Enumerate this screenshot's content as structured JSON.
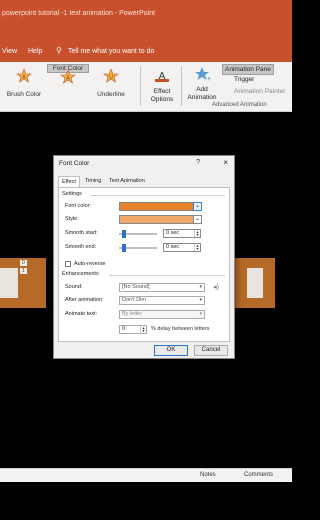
{
  "titlebar": {
    "title": "powerpoint tutorial -1 text animation  -  PowerPoint"
  },
  "menubar": {
    "view": "View",
    "help": "Help",
    "tell_me": "Tell me what you want to do"
  },
  "ribbon": {
    "buttons": [
      {
        "label": "Brush Color"
      },
      {
        "label": "Font Color"
      },
      {
        "label": "Underline"
      }
    ],
    "effect_options": "Effect Options",
    "add_animation": "Add Animation",
    "animation_pane": "Animation Pane",
    "trigger": "Trigger",
    "animation_painter": "Animation Painter",
    "group_label": "Advanced Animation"
  },
  "status": {
    "notes": "Notes",
    "comments": "Comments"
  },
  "slide": {
    "badge_top": "0",
    "badge_bottom": "1"
  },
  "dialog": {
    "title": "Font Color",
    "help": "?",
    "close": "×",
    "tabs": [
      "Effect",
      "Timing",
      "Text Animation"
    ],
    "settings_label": "Settings",
    "font_color_label": "Font color:",
    "style_label": "Style:",
    "smooth_start_label": "Smooth start:",
    "smooth_end_label": "Smooth end:",
    "smooth_start_value": "0 sec",
    "smooth_end_value": "0 sec",
    "auto_reverse_label": "Auto-reverse",
    "enhancements_label": "Enhancements",
    "sound_label": "Sound:",
    "sound_value": "[No Sound]",
    "after_animation_label": "After animation:",
    "after_animation_value": "Don't Dim",
    "animate_text_label": "Animate text:",
    "animate_text_value": "By letter",
    "delay_value": "0",
    "delay_label": "% delay between letters",
    "ok": "OK",
    "cancel": "Cancel",
    "colors": {
      "font_color": "#e6802a",
      "style_color": "#f0a86a"
    }
  }
}
